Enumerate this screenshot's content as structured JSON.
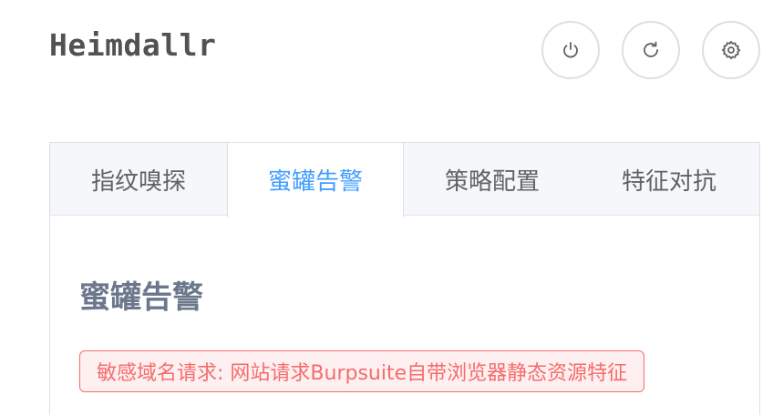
{
  "app": {
    "title": "Heimdallr"
  },
  "toolbar": {
    "buttons": [
      {
        "icon": "power-icon"
      },
      {
        "icon": "refresh-icon"
      },
      {
        "icon": "gear-icon"
      }
    ]
  },
  "tabs": [
    {
      "label": "指纹嗅探",
      "active": false
    },
    {
      "label": "蜜罐告警",
      "active": true
    },
    {
      "label": "策略配置",
      "active": false
    },
    {
      "label": "特征对抗",
      "active": false
    }
  ],
  "panel": {
    "heading": "蜜罐告警",
    "alerts": [
      {
        "text": "敏感域名请求: 网站请求Burpsuite自带浏览器静态资源特征"
      }
    ]
  },
  "colors": {
    "accent": "#409eff",
    "alert_red": "#f56c6c",
    "alert_bg": "#fef0f0"
  }
}
